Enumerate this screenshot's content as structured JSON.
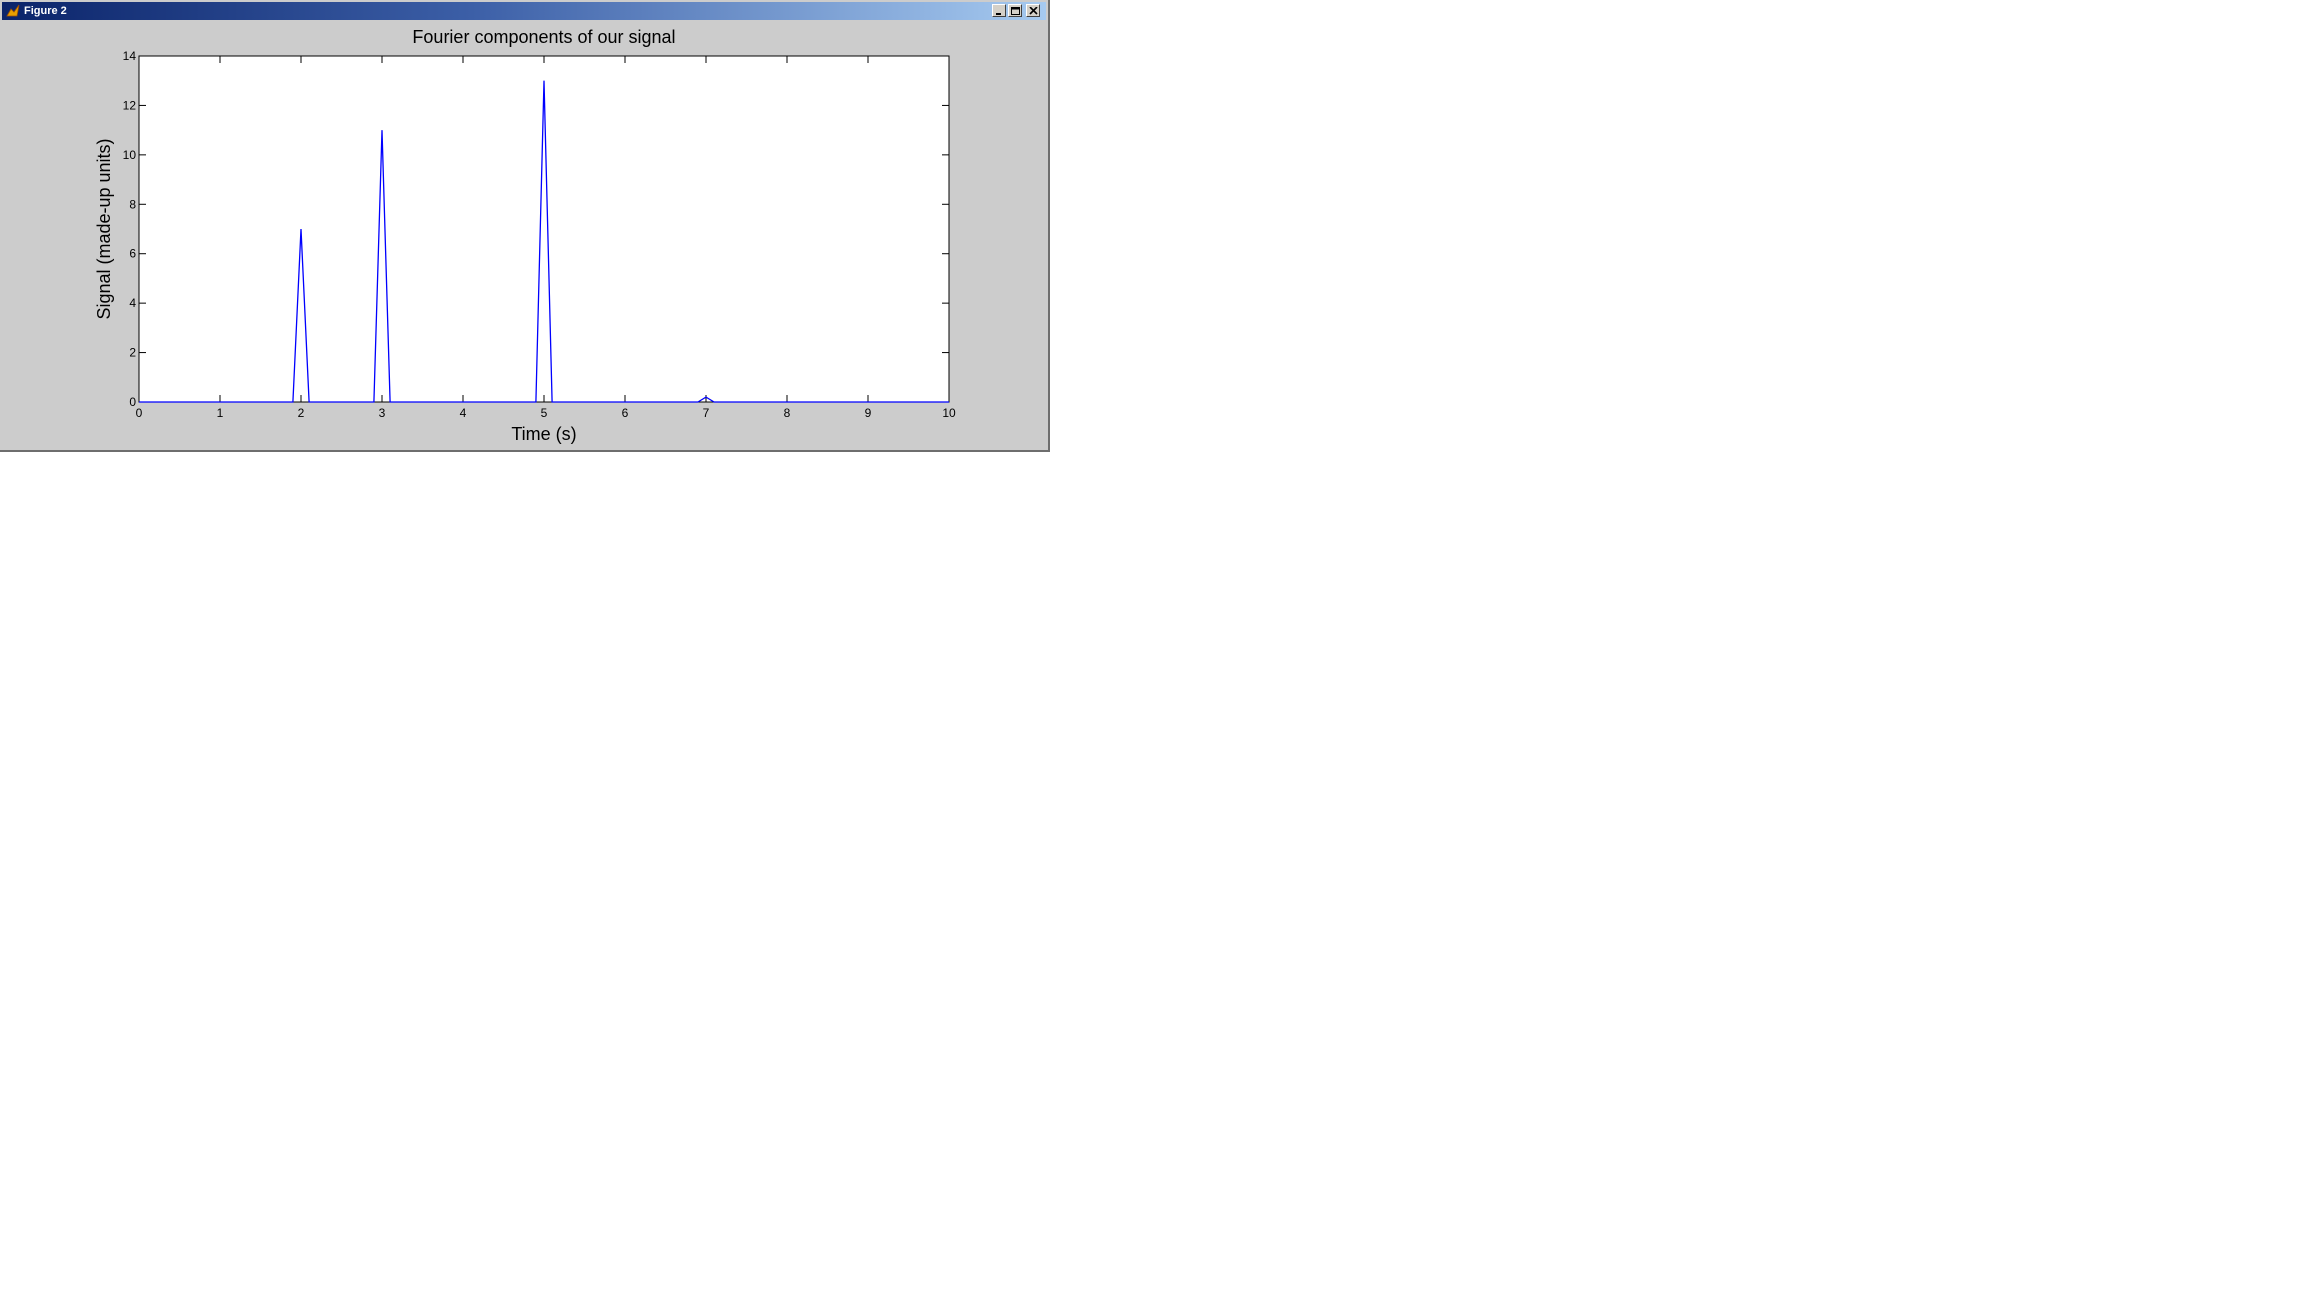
{
  "window": {
    "title": "Figure 2"
  },
  "chart_data": {
    "type": "line",
    "title": "Fourier components of our signal",
    "xlabel": "Time (s)",
    "ylabel": "Signal (made-up units)",
    "xlim": [
      0,
      10
    ],
    "ylim": [
      0,
      14
    ],
    "xticks": [
      0,
      1,
      2,
      3,
      4,
      5,
      6,
      7,
      8,
      9,
      10
    ],
    "yticks": [
      0,
      2,
      4,
      6,
      8,
      10,
      12,
      14
    ],
    "grid": false,
    "series": [
      {
        "color": "#0000ff",
        "x": [
          0,
          1.9,
          2.0,
          2.1,
          2.9,
          3.0,
          3.1,
          4.9,
          5.0,
          5.1,
          6.9,
          7.0,
          7.1,
          10
        ],
        "y": [
          0,
          0,
          7,
          0,
          0,
          11,
          0,
          0,
          13,
          0,
          0,
          0.2,
          0,
          0
        ]
      }
    ]
  }
}
